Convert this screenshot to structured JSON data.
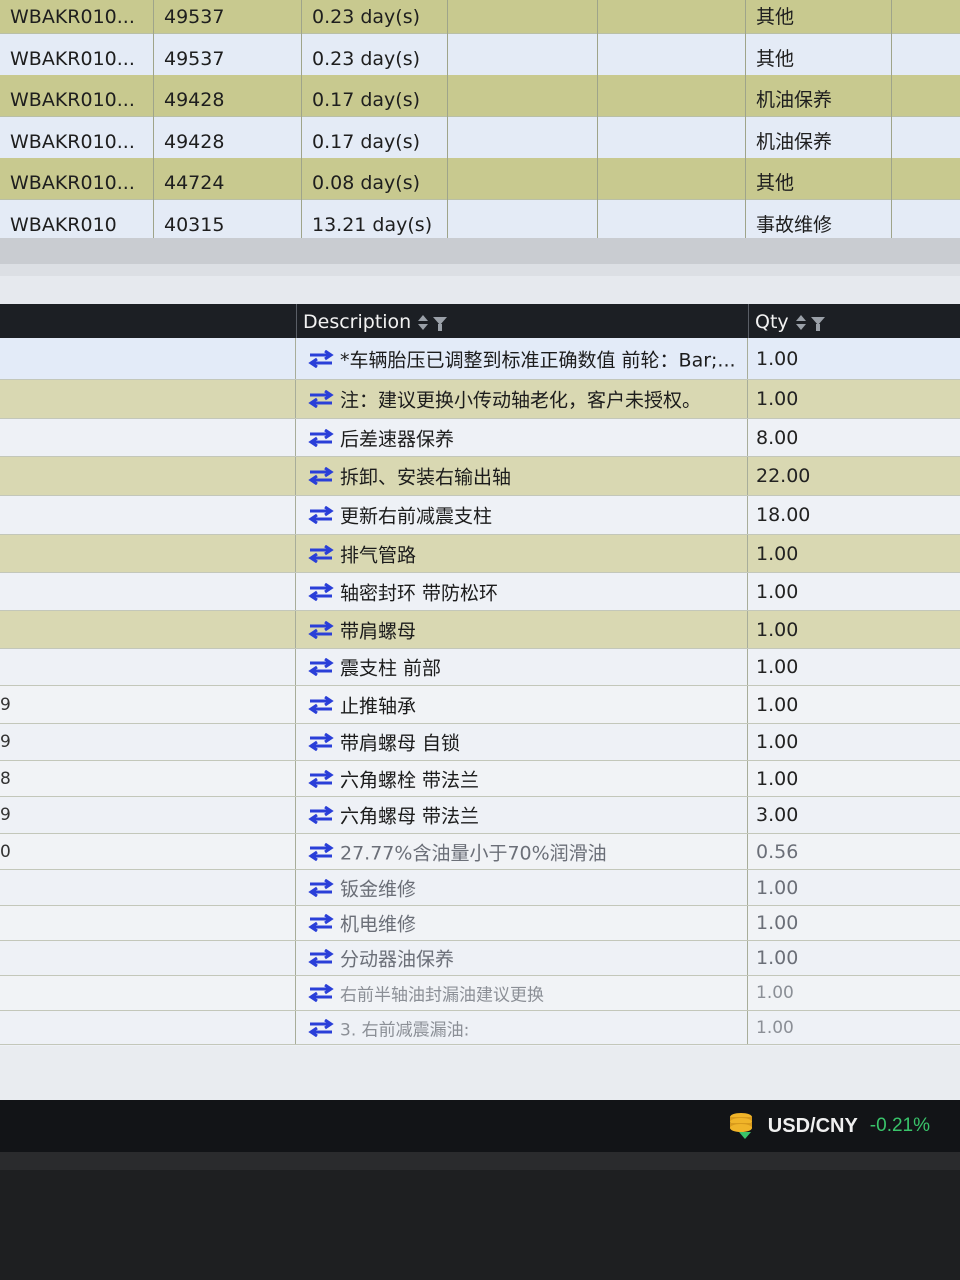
{
  "top_table": {
    "rows": [
      {
        "code": "WBAKR010...",
        "number": "49537",
        "duration": "0.23 day(s)",
        "type": "其他",
        "tone": "olive"
      },
      {
        "code": "WBAKR010...",
        "number": "49537",
        "duration": "0.23 day(s)",
        "type": "其他",
        "tone": "light"
      },
      {
        "code": "WBAKR010...",
        "number": "49428",
        "duration": "0.17 day(s)",
        "type": "机油保养",
        "tone": "olive"
      },
      {
        "code": "WBAKR010...",
        "number": "49428",
        "duration": "0.17 day(s)",
        "type": "机油保养",
        "tone": "light"
      },
      {
        "code": "WBAKR010...",
        "number": "44724",
        "duration": "0.08 day(s)",
        "type": "其他",
        "tone": "olive"
      },
      {
        "code": "WBAKR010",
        "number": "40315",
        "duration": "13.21 day(s)",
        "type": "事故维修",
        "tone": "light"
      }
    ]
  },
  "items_table": {
    "headers": {
      "description": "Description",
      "qty": "Qty"
    },
    "rows": [
      {
        "lead": "",
        "description": "*车辆胎压已调整到标准正确数值 前轮：Bar;...",
        "qty": "1.00",
        "tone": "blue"
      },
      {
        "lead": "",
        "description": "注：建议更换小传动轴老化，客户未授权。",
        "qty": "1.00",
        "tone": "olive"
      },
      {
        "lead": "",
        "description": "后差速器保养",
        "qty": "8.00",
        "tone": "light"
      },
      {
        "lead": "",
        "description": "拆卸、安装右输出轴",
        "qty": "22.00",
        "tone": "olive"
      },
      {
        "lead": "",
        "description": "更新右前减震支柱",
        "qty": "18.00",
        "tone": "light"
      },
      {
        "lead": "",
        "description": "排气管路",
        "qty": "1.00",
        "tone": "olive"
      },
      {
        "lead": "",
        "description": "轴密封环 带防松环",
        "qty": "1.00",
        "tone": "light"
      },
      {
        "lead": "",
        "description": "带肩螺母",
        "qty": "1.00",
        "tone": "olive"
      },
      {
        "lead": "",
        "description": "震支柱 前部",
        "qty": "1.00",
        "tone": "light"
      },
      {
        "lead": "9",
        "description": "止推轴承",
        "qty": "1.00",
        "tone": "plain"
      },
      {
        "lead": "9",
        "description": "带肩螺母 自锁",
        "qty": "1.00",
        "tone": "light"
      },
      {
        "lead": "8",
        "description": "六角螺栓 带法兰",
        "qty": "1.00",
        "tone": "plain"
      },
      {
        "lead": "9",
        "description": "六角螺母 带法兰",
        "qty": "3.00",
        "tone": "light"
      },
      {
        "lead": "0",
        "description": "27.77%含油量小于70%润滑油",
        "qty": "0.56",
        "tone": "plain"
      },
      {
        "lead": "",
        "description": "钣金维修",
        "qty": "1.00",
        "tone": "light"
      },
      {
        "lead": "",
        "description": "机电维修",
        "qty": "1.00",
        "tone": "plain"
      },
      {
        "lead": "",
        "description": "分动器油保养",
        "qty": "1.00",
        "tone": "light"
      },
      {
        "lead": "",
        "description": "右前半轴油封漏油建议更换",
        "qty": "1.00",
        "tone": "plain"
      },
      {
        "lead": "",
        "description": "3. 右前减震漏油:",
        "qty": "1.00",
        "tone": "light"
      }
    ]
  },
  "taskbar": {
    "fx_pair": "USD/CNY",
    "fx_change": "-0.21%"
  },
  "colors": {
    "icon_blue": "#2a3fd8",
    "header_bg": "#1c1f24",
    "fx_green": "#39c46a"
  }
}
